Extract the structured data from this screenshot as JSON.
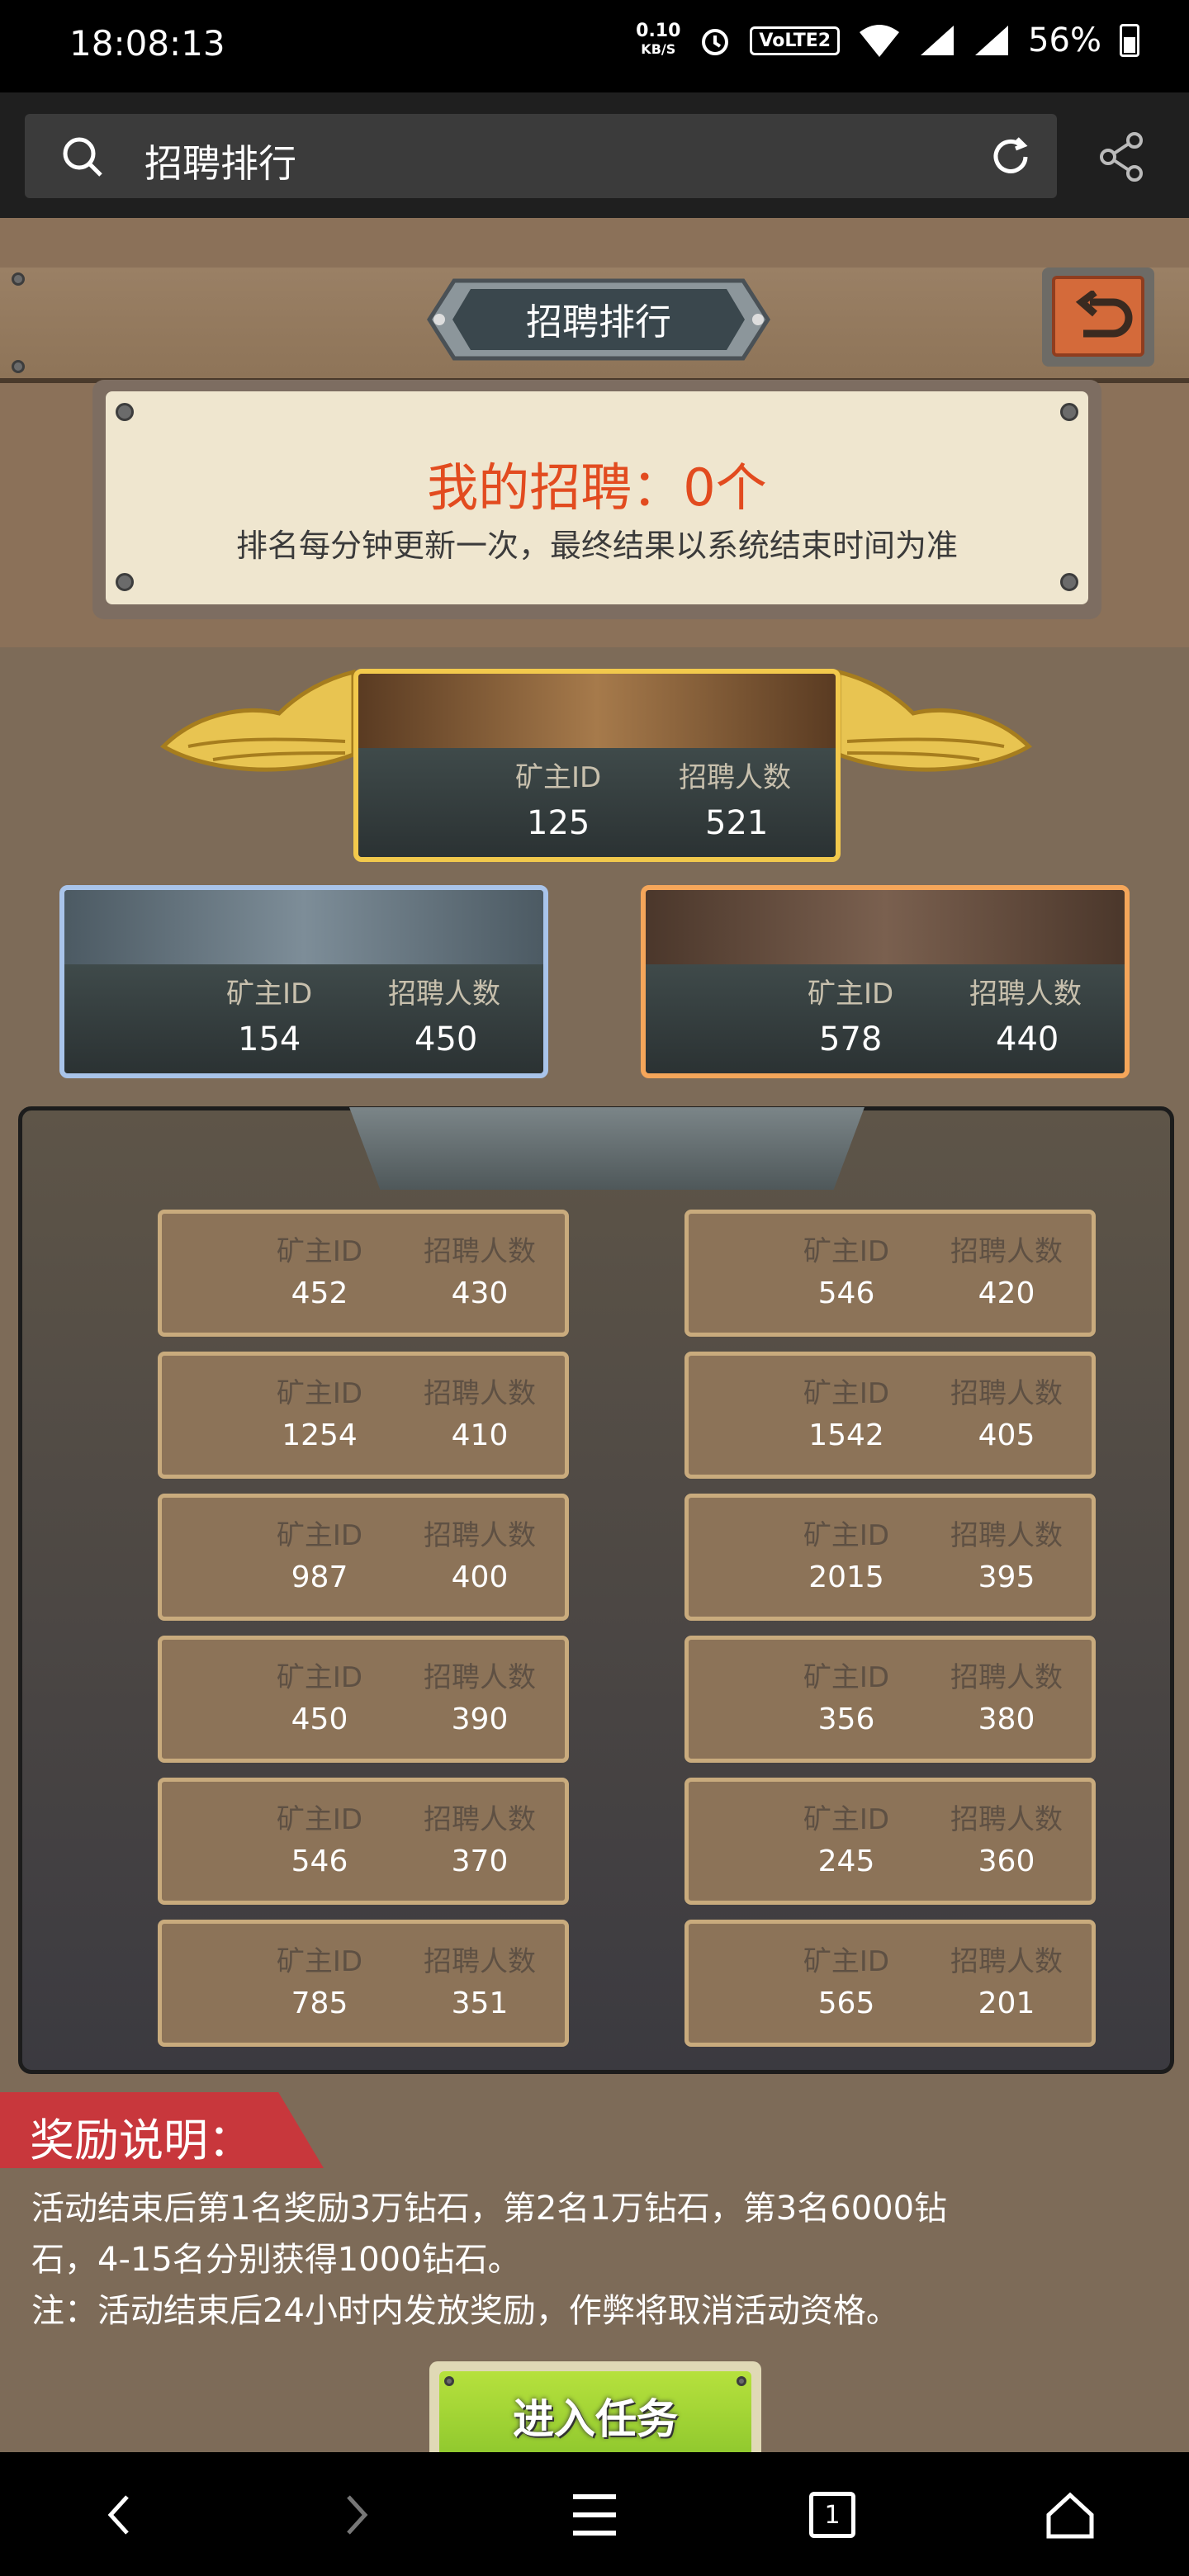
{
  "status_bar": {
    "time": "18:08:13",
    "net_speed": "0.10",
    "net_unit": "KB/S",
    "volte": "VoLTE2",
    "battery": "56%"
  },
  "browser": {
    "title": "招聘排行"
  },
  "game": {
    "header_title": "招聘排行",
    "my_recruit": "我的招聘：0个",
    "update_note": "排名每分钟更新一次，最终结果以系统结束时间为准",
    "header_id": "矿主ID",
    "header_count": "招聘人数",
    "top3": [
      {
        "rank": 1,
        "id": "125",
        "count": "521"
      },
      {
        "rank": 2,
        "id": "154",
        "count": "450"
      },
      {
        "rank": 3,
        "id": "578",
        "count": "440"
      }
    ],
    "ranks": [
      {
        "id": "452",
        "count": "430"
      },
      {
        "id": "546",
        "count": "420"
      },
      {
        "id": "1254",
        "count": "410"
      },
      {
        "id": "1542",
        "count": "405"
      },
      {
        "id": "987",
        "count": "400"
      },
      {
        "id": "2015",
        "count": "395"
      },
      {
        "id": "450",
        "count": "390"
      },
      {
        "id": "356",
        "count": "380"
      },
      {
        "id": "546",
        "count": "370"
      },
      {
        "id": "245",
        "count": "360"
      },
      {
        "id": "785",
        "count": "351"
      },
      {
        "id": "565",
        "count": "201"
      }
    ],
    "reward_title": "奖励说明：",
    "reward_line1": "活动结束后第1名奖励3万钻石，第2名1万钻石，第3名6000钻",
    "reward_line2": "石，4-15名分别获得1000钻石。",
    "reward_line3": "注：活动结束后24小时内发放奖励，作弊将取消活动资格。",
    "enter_button": "进入任务"
  },
  "nav": {
    "tabs_count": "1"
  }
}
